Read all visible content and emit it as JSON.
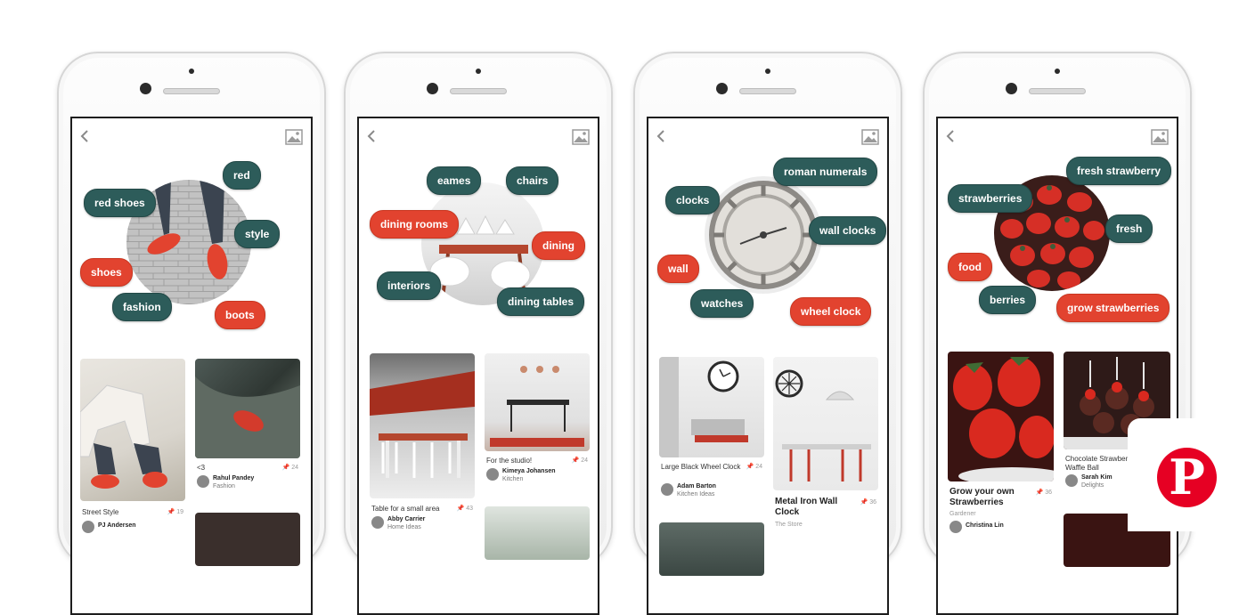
{
  "phones": [
    {
      "tags": [
        "red",
        "red shoes",
        "style",
        "shoes",
        "fashion",
        "boots"
      ],
      "pins": [
        {
          "title": "Street Style",
          "count": "19",
          "user": "PJ Andersen"
        },
        {
          "title": "<3",
          "count": "24",
          "user": "Rahul Pandey",
          "board": "Fashion"
        }
      ]
    },
    {
      "tags": [
        "eames",
        "chairs",
        "dining rooms",
        "dining",
        "interiors",
        "dining tables"
      ],
      "pins": [
        {
          "title": "Table for a small area",
          "count": "43",
          "user": "Abby Carrier",
          "board": "Home Ideas"
        },
        {
          "title": "For the studio!",
          "count": "24",
          "user": "Kimeya Johansen",
          "board": "Kitchen"
        }
      ]
    },
    {
      "tags": [
        "roman numerals",
        "clocks",
        "wall clocks",
        "wall",
        "watches",
        "wheel clock"
      ],
      "pins": [
        {
          "title": "Large Black Wheel Clock",
          "count": "24",
          "user": "Adam Barton",
          "board": "Kitchen Ideas"
        },
        {
          "title": "Metal Iron Wall Clock",
          "count": "36",
          "sub": "The Store"
        }
      ]
    },
    {
      "tags": [
        "fresh strawberry",
        "strawberries",
        "fresh",
        "food",
        "berries",
        "grow strawberries"
      ],
      "pins": [
        {
          "title": "Grow your own Strawberries",
          "count": "36",
          "sub": "Gardener",
          "user": "Christina Lin"
        },
        {
          "title": "Chocolate Strawberry Waffle Ball",
          "user": "Sarah Kim",
          "board": "Delights"
        }
      ]
    }
  ],
  "logo": {
    "letter": "P"
  },
  "colors": {
    "teal": "#2d5c5a",
    "red": "#e2432f",
    "brand": "#e60023"
  }
}
